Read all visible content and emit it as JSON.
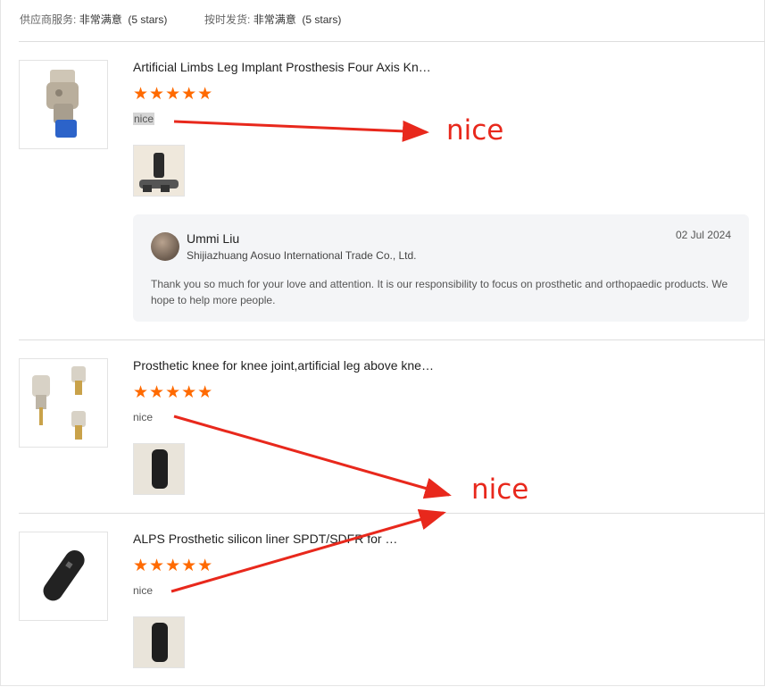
{
  "summary": {
    "supplier_label": "供应商服务:",
    "supplier_value": "非常满意",
    "supplier_stars": "(5 stars)",
    "shipping_label": "按时发货:",
    "shipping_value": "非常满意",
    "shipping_stars": "(5 stars)"
  },
  "reviews": [
    {
      "title": "Artificial Limbs Leg Implant Prosthesis Four Axis Kn…",
      "rating": 5,
      "stars": "★★★★★",
      "comment": "nice",
      "product_icon": "knee-joint-image",
      "photo_icon": "prosthesis-photo",
      "reply": {
        "name": "Ummi Liu",
        "company": "Shijiazhuang Aosuo International Trade Co., Ltd.",
        "date": "02 Jul 2024",
        "text": "Thank you so much for your love and attention. It is our responsibility to focus on prosthetic and orthopaedic products. We hope to help more people."
      }
    },
    {
      "title": "Prosthetic knee for knee joint,artificial leg above kne…",
      "rating": 5,
      "stars": "★★★★★",
      "comment": "nice",
      "product_icon": "knee-joints-image",
      "photo_icon": "liner-photo"
    },
    {
      "title": "ALPS Prosthetic silicon liner SPDT/SDFR for …",
      "rating": 5,
      "stars": "★★★★★",
      "comment": "nice",
      "product_icon": "silicon-liner-image",
      "photo_icon": "liner-photo"
    }
  ],
  "annotations": [
    {
      "text": "nice",
      "color": "#e8281c"
    },
    {
      "text": "nice",
      "color": "#e8281c"
    }
  ],
  "colors": {
    "star": "#ff6a00",
    "annotation": "#e8281c",
    "reply_bg": "#f4f5f7"
  }
}
